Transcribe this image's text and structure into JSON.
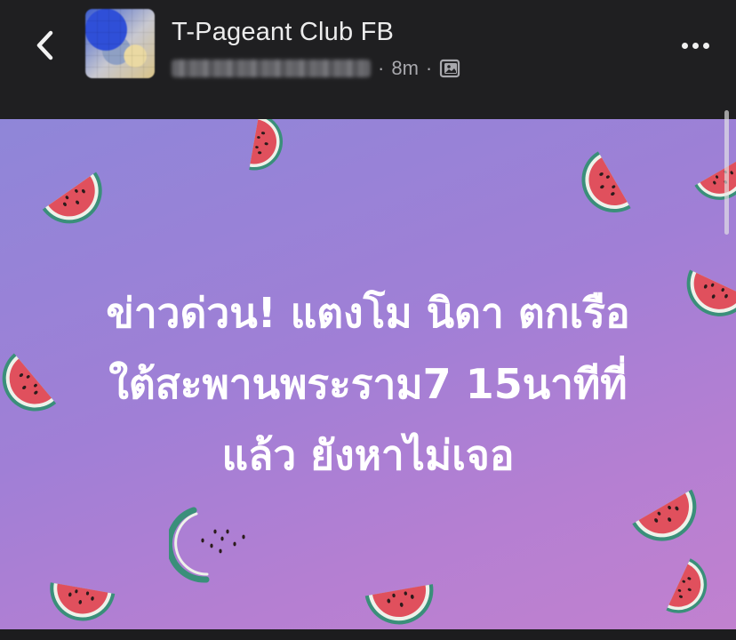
{
  "header": {
    "back_icon": "chevron-left-icon",
    "page_name": "T-Pageant Club FB",
    "separator": "·",
    "time": "8m",
    "audience_icon": "photo-album-icon",
    "more_icon": "more-horizontal-icon"
  },
  "post": {
    "lines": [
      "ข่าวด่วน! แตงโม นิดา ตกเรือ",
      "ใต้สะพานพระราม7 15นาทีที่",
      "แล้ว ยังหาไม่เจอ"
    ],
    "background_colors": [
      "#8f86d8",
      "#c181cf"
    ],
    "decoration_icon": "watermelon-slice-icon"
  }
}
